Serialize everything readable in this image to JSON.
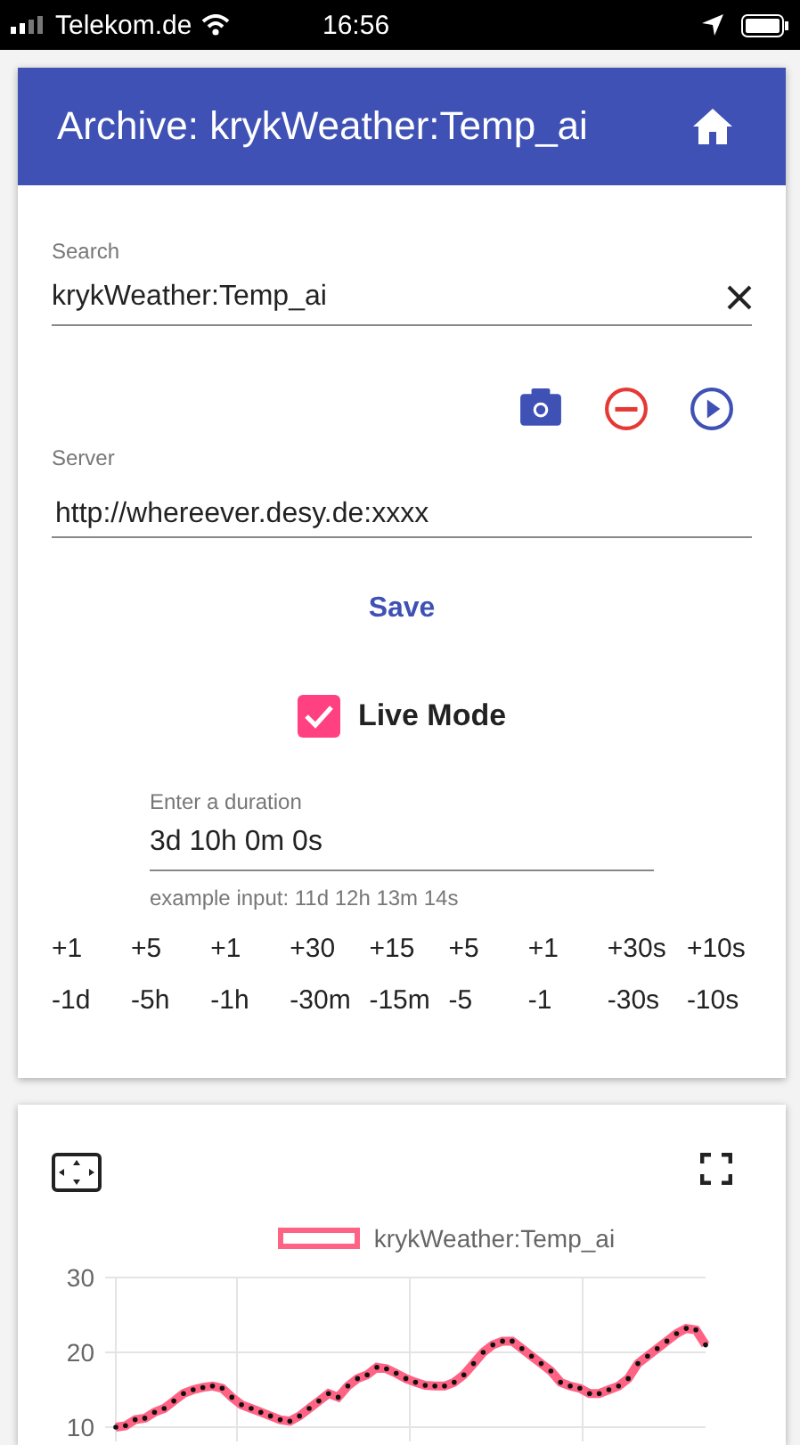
{
  "status_bar": {
    "carrier": "Telekom.de",
    "time": "16:56"
  },
  "header": {
    "title": "Archive: krykWeather:Temp_ai"
  },
  "search": {
    "label": "Search",
    "value": "krykWeather:Temp_ai"
  },
  "actions": [
    {
      "kind": "camera"
    },
    {
      "kind": "remove"
    },
    {
      "kind": "play"
    }
  ],
  "server": {
    "label": "Server",
    "value": "http://whereever.desy.de:xxxx"
  },
  "save_button": "Save",
  "live_mode": {
    "label": "Live Mode",
    "checked": true
  },
  "duration": {
    "label": "Enter a duration",
    "value": "3d 10h 0m 0s",
    "hint": "example input: 11d 12h 13m 14s"
  },
  "increment_buttons": [
    "+1",
    "+5",
    "+1",
    "+30",
    "+15",
    "+5",
    "+1",
    "+30s",
    "+10s"
  ],
  "decrement_buttons": [
    "-1d",
    "-5h",
    "-1h",
    "-30m",
    "-15m",
    "-5",
    "-1",
    "-30s",
    "-10s"
  ],
  "chart": {
    "chart_data": {
      "type": "line",
      "ylim": [
        10,
        30
      ],
      "grid": true,
      "yticks": [
        10,
        20,
        30
      ],
      "series": [
        {
          "name": "krykWeather:Temp_ai",
          "color": "#ff6384",
          "values": [
            10,
            10.2,
            11,
            11.2,
            12,
            12.5,
            13.5,
            14.5,
            15,
            15.3,
            15.5,
            15.2,
            14,
            13,
            12.5,
            12,
            11.5,
            11,
            10.8,
            11.5,
            12.5,
            13.5,
            14.5,
            14,
            15.5,
            16.5,
            17,
            18,
            17.8,
            17.2,
            16.5,
            16,
            15.6,
            15.5,
            15.5,
            16,
            17,
            18.5,
            20,
            21,
            21.5,
            21.5,
            20.5,
            19.5,
            18.5,
            17.5,
            16,
            15.5,
            15.2,
            14.5,
            14.5,
            15,
            15.5,
            16.5,
            18.5,
            19.5,
            20.5,
            21.5,
            22.5,
            23.2,
            23,
            21
          ]
        }
      ]
    }
  }
}
